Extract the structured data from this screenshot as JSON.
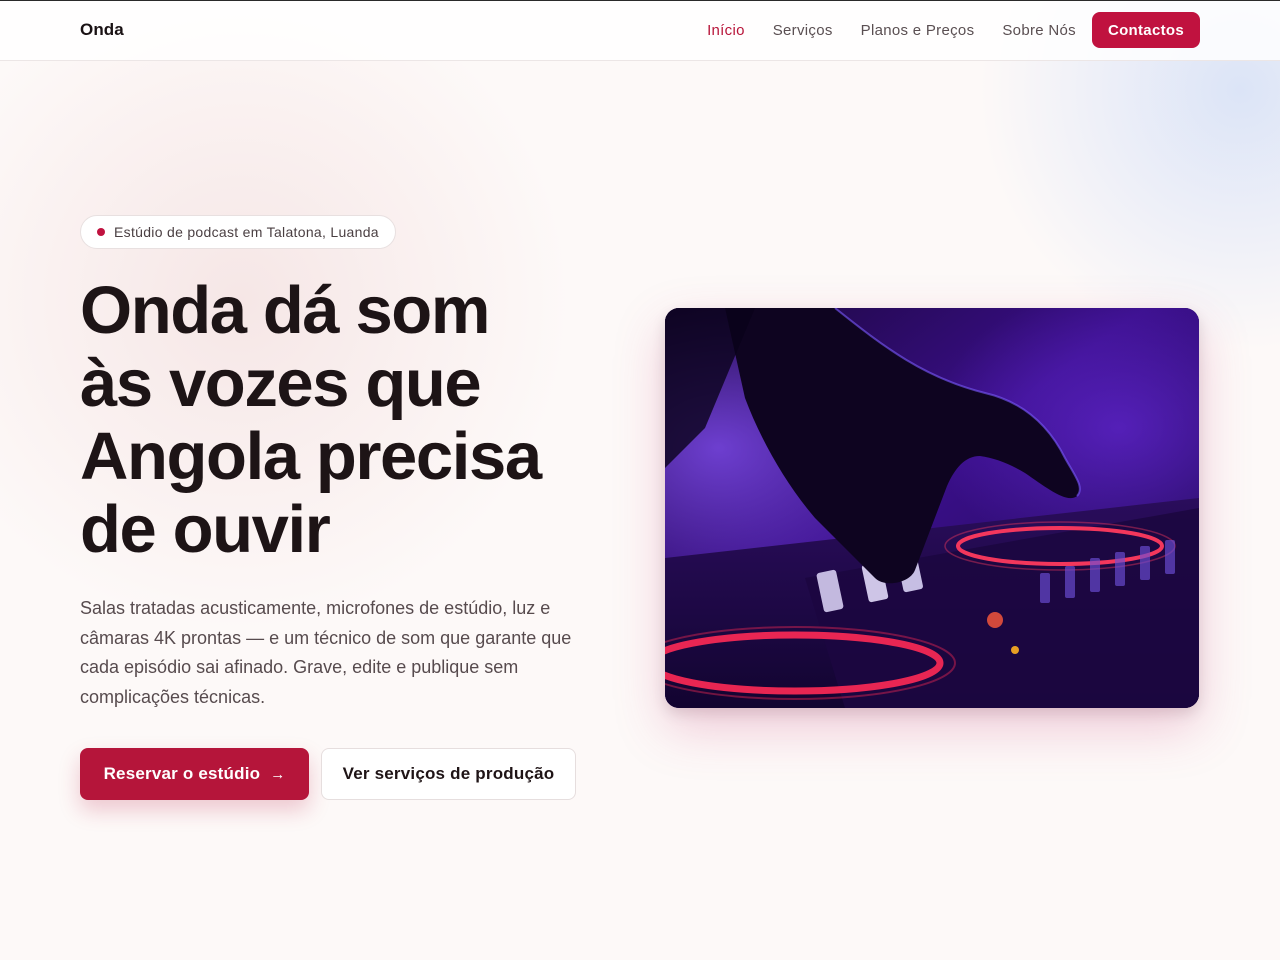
{
  "header": {
    "logo": "Onda",
    "nav": [
      {
        "label": "Início",
        "active": true
      },
      {
        "label": "Serviços"
      },
      {
        "label": "Planos e Preços"
      },
      {
        "label": "Sobre Nós"
      }
    ],
    "cta_label": "Contactos"
  },
  "hero": {
    "badge": "Estúdio de podcast em Talatona, Luanda",
    "title_lines": [
      "Onda dá som",
      "às vozes que",
      "Angola precisa",
      "de ouvir"
    ],
    "lead": "Salas tratadas acusticamente, microfones de estúdio, luz e câmaras 4K prontas — e um técnico de som que garante que cada episódio sai afinado. Grave, edite e publique sem complicações técnicas.",
    "primary_button": "Reservar o estúdio",
    "primary_button_icon": "arrow-right-icon",
    "secondary_button": "Ver serviços de produção",
    "image_subject": "hand-on-dj-controller-image"
  },
  "colors": {
    "accent": "#c0123f",
    "text": "#1d1416",
    "muted": "#574b4e",
    "background": "#fdf9f8"
  }
}
